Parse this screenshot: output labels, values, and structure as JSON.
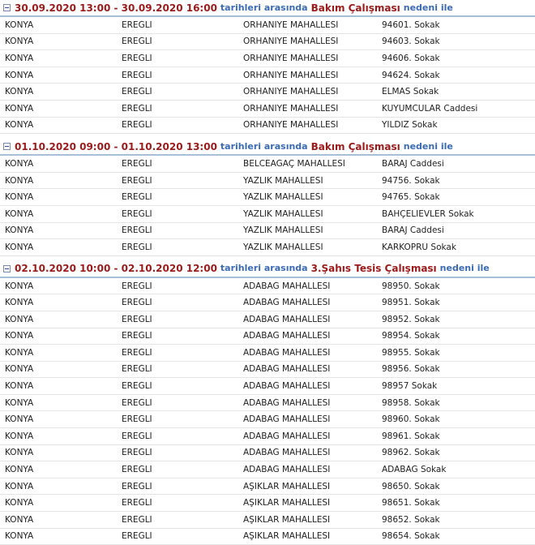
{
  "groups": [
    {
      "date_range": "30.09.2020 13:00 - 30.09.2020 16:00",
      "between_text": "tarihleri arasında",
      "reason": "Bakım Çalışması",
      "reason_suffix": "nedeni ile",
      "rows": [
        [
          "KONYA",
          "EREĞLİ",
          "ORHANİYE MAHALLESİ",
          "94601. Sokak"
        ],
        [
          "KONYA",
          "EREĞLİ",
          "ORHANİYE MAHALLESİ",
          "94603. Sokak"
        ],
        [
          "KONYA",
          "EREĞLİ",
          "ORHANİYE MAHALLESİ",
          "94606. Sokak"
        ],
        [
          "KONYA",
          "EREĞLİ",
          "ORHANİYE MAHALLESİ",
          "94624. Sokak"
        ],
        [
          "KONYA",
          "EREĞLİ",
          "ORHANİYE MAHALLESİ",
          "ELMAS Sokak"
        ],
        [
          "KONYA",
          "EREĞLİ",
          "ORHANİYE MAHALLESİ",
          "KUYUMCULAR Caddesi"
        ],
        [
          "KONYA",
          "EREĞLİ",
          "ORHANİYE MAHALLESİ",
          "YILDIZ Sokak"
        ]
      ]
    },
    {
      "date_range": "01.10.2020 09:00 - 01.10.2020 13:00",
      "between_text": "tarihleri arasında",
      "reason": "Bakım Çalışması",
      "reason_suffix": "nedeni ile",
      "rows": [
        [
          "KONYA",
          "EREĞLİ",
          "BELCEAĞAÇ MAHALLESİ",
          "BARAJ Caddesi"
        ],
        [
          "KONYA",
          "EREĞLİ",
          "YAZLIK MAHALLESİ",
          "94756. Sokak"
        ],
        [
          "KONYA",
          "EREĞLİ",
          "YAZLIK MAHALLESİ",
          "94765. Sokak"
        ],
        [
          "KONYA",
          "EREĞLİ",
          "YAZLIK MAHALLESİ",
          "BAHÇELİEVLER Sokak"
        ],
        [
          "KONYA",
          "EREĞLİ",
          "YAZLIK MAHALLESİ",
          "BARAJ Caddesi"
        ],
        [
          "KONYA",
          "EREĞLİ",
          "YAZLIK MAHALLESİ",
          "KARKÖPRÜ Sokak"
        ]
      ]
    },
    {
      "date_range": "02.10.2020 10:00 - 02.10.2020 12:00",
      "between_text": "tarihleri arasında",
      "reason": "3.Şahıs Tesis Çalışması",
      "reason_suffix": "nedeni ile",
      "rows": [
        [
          "KONYA",
          "EREĞLİ",
          "ADABAĞ MAHALLESİ",
          "98950. Sokak"
        ],
        [
          "KONYA",
          "EREĞLİ",
          "ADABAĞ MAHALLESİ",
          "98951. Sokak"
        ],
        [
          "KONYA",
          "EREĞLİ",
          "ADABAĞ MAHALLESİ",
          "98952. Sokak"
        ],
        [
          "KONYA",
          "EREĞLİ",
          "ADABAĞ MAHALLESİ",
          "98954. Sokak"
        ],
        [
          "KONYA",
          "EREĞLİ",
          "ADABAĞ MAHALLESİ",
          "98955. Sokak"
        ],
        [
          "KONYA",
          "EREĞLİ",
          "ADABAĞ MAHALLESİ",
          "98956. Sokak"
        ],
        [
          "KONYA",
          "EREĞLİ",
          "ADABAĞ MAHALLESİ",
          "98957 Sokak"
        ],
        [
          "KONYA",
          "EREĞLİ",
          "ADABAĞ MAHALLESİ",
          "98958. Sokak"
        ],
        [
          "KONYA",
          "EREĞLİ",
          "ADABAĞ MAHALLESİ",
          "98960. Sokak"
        ],
        [
          "KONYA",
          "EREĞLİ",
          "ADABAĞ MAHALLESİ",
          "98961. Sokak"
        ],
        [
          "KONYA",
          "EREĞLİ",
          "ADABAĞ MAHALLESİ",
          "98962. Sokak"
        ],
        [
          "KONYA",
          "EREĞLİ",
          "ADABAĞ MAHALLESİ",
          "ADABAĞ Sokak"
        ],
        [
          "KONYA",
          "EREĞLİ",
          "AŞIKLAR MAHALLESİ",
          "98650. Sokak"
        ],
        [
          "KONYA",
          "EREĞLİ",
          "AŞIKLAR MAHALLESİ",
          "98651. Sokak"
        ],
        [
          "KONYA",
          "EREĞLİ",
          "AŞIKLAR MAHALLESİ",
          "98652. Sokak"
        ],
        [
          "KONYA",
          "EREĞLİ",
          "AŞIKLAR MAHALLESİ",
          "98654. Sokak"
        ]
      ]
    }
  ]
}
